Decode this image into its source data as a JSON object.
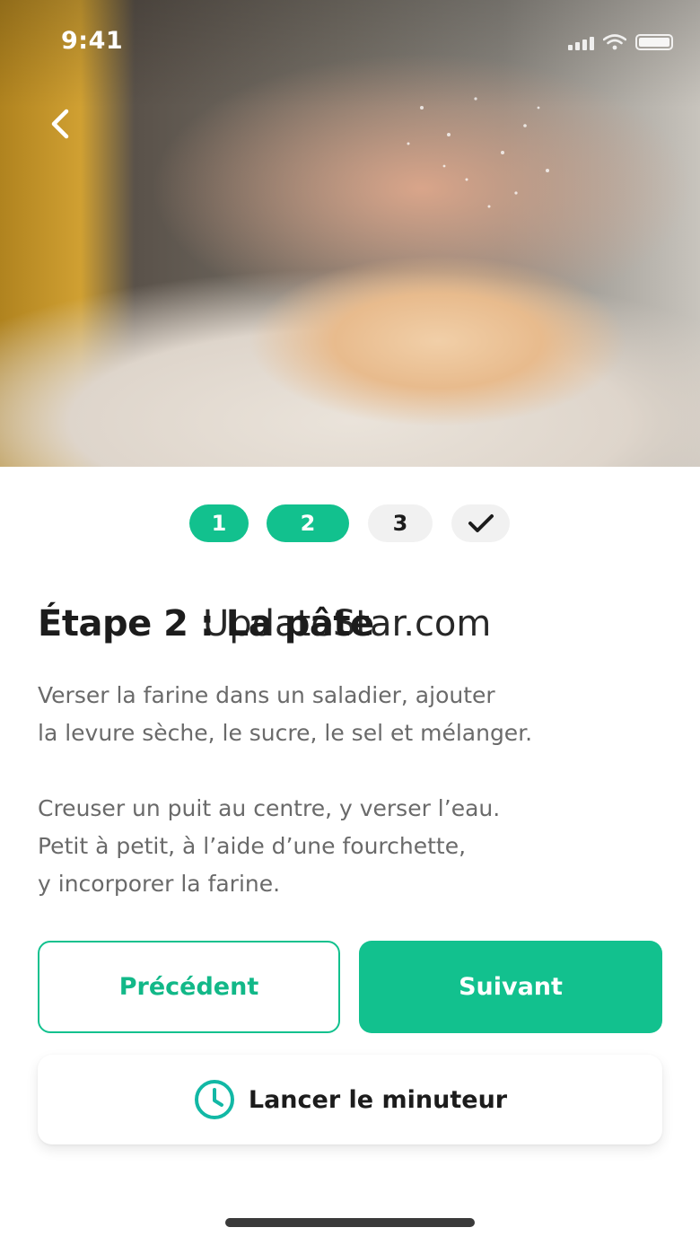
{
  "status_bar": {
    "time": "9:41"
  },
  "steps": [
    {
      "label": "1",
      "state": "done"
    },
    {
      "label": "2",
      "state": "current"
    },
    {
      "label": "3",
      "state": "upcoming"
    },
    {
      "label": "",
      "state": "final",
      "icon": "check-icon"
    }
  ],
  "title": "Étape 2 : La pâte",
  "watermark": "UpdateStar.com",
  "description": {
    "paragraph_1": [
      "Verser la farine dans un saladier, ajouter",
      "la levure sèche, le sucre, le sel et mélanger."
    ],
    "paragraph_2": [
      "Creuser un puit au centre, y verser l’eau.",
      "Petit à petit, à l’aide d’une fourchette,",
      "y incorporer la farine."
    ]
  },
  "buttons": {
    "previous": "Précédent",
    "next": "Suivant"
  },
  "timer": {
    "label": "Lancer le minuteur",
    "icon": "clock-icon"
  },
  "colors": {
    "accent": "#12c18e",
    "text": "#1c1c1c",
    "muted": "#6a6a6a",
    "pill_inactive": "#f1f1f1"
  }
}
